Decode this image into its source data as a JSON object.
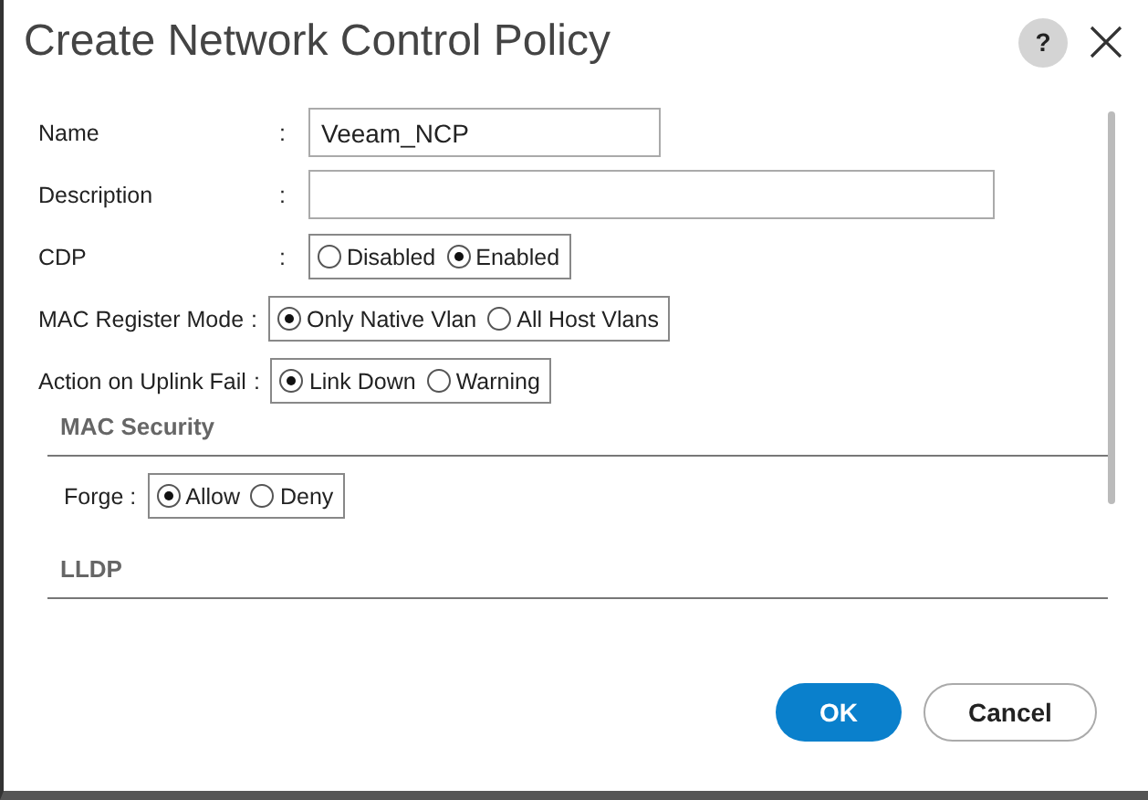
{
  "dialog": {
    "title": "Create Network Control Policy",
    "help": "?"
  },
  "fields": [
    {
      "kind": "text",
      "label": "Name",
      "colon": ":",
      "value": "Veeam_NCP"
    },
    {
      "kind": "longtext",
      "label": "Description",
      "colon": ":"
    },
    {
      "kind": "radio",
      "label": "CDP",
      "colon": ":",
      "options": [
        {
          "label": "Disabled",
          "selected": false
        },
        {
          "label": "Enabled",
          "selected": true
        }
      ]
    },
    {
      "kind": "radio",
      "label": "MAC Register Mode",
      "colon": ":",
      "options": [
        {
          "label": "Only Native Vlan",
          "selected": true
        },
        {
          "label": "All Host Vlans",
          "selected": false
        }
      ]
    },
    {
      "kind": "radio",
      "label": "Action on Uplink Fail",
      "colon": ":",
      "options": [
        {
          "label": "Link Down",
          "selected": true
        },
        {
          "label": "Warning",
          "selected": false
        }
      ]
    }
  ],
  "sections": [
    {
      "title": "MAC Security",
      "fields": [
        {
          "kind": "radio",
          "label": "Forge :",
          "options": [
            {
              "label": "Allow",
              "selected": true
            },
            {
              "label": "Deny",
              "selected": false
            }
          ]
        }
      ]
    },
    {
      "title": "LLDP"
    }
  ],
  "buttons": [
    {
      "label": "OK",
      "kind": "primary"
    },
    {
      "label": "Cancel",
      "kind": "secondary"
    }
  ]
}
